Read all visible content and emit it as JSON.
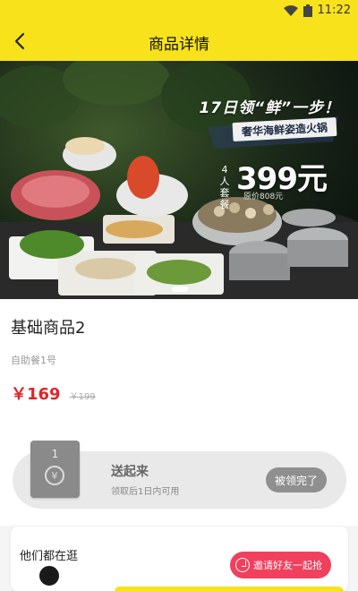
{
  "status_bar": {
    "time": "11:22",
    "accent": "#f7e21b"
  },
  "nav": {
    "title": "商品详情",
    "back_icon": "chevron-left-icon"
  },
  "banner": {
    "headline": "17日领“鲜”一步！",
    "subline": "奢华海鲜姿造火锅",
    "per_person": "4人套餐",
    "price": "399元",
    "original_price": "原价808元"
  },
  "product": {
    "name": "基础商品2",
    "subtitle": "自助餐1号",
    "price": "￥169",
    "original_price": "￥199",
    "price_color": "#e0242a"
  },
  "coupon": {
    "ticket_number": "1",
    "currency_symbol": "¥",
    "title": "送起来",
    "description": "领取后1日内可用",
    "button_label": "被领完了"
  },
  "browsing": {
    "title": "他们都在逛",
    "invite_button": "邀请好友一起抢",
    "invite_color": "#f0405d"
  }
}
